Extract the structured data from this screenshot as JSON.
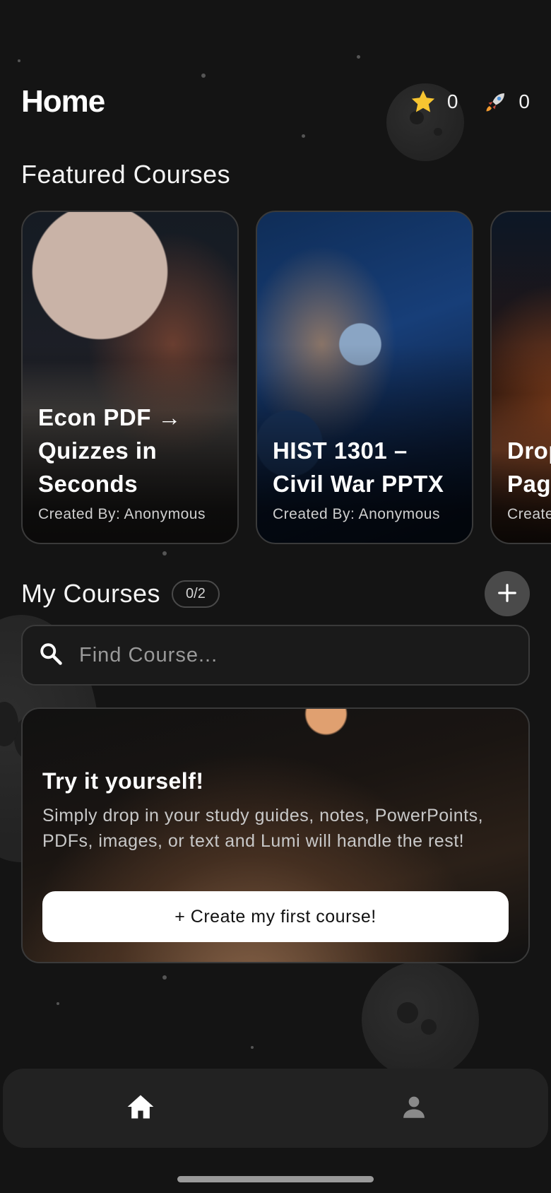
{
  "header": {
    "title": "Home",
    "stars": {
      "icon": "star-icon",
      "value": "0"
    },
    "rockets": {
      "icon": "rocket-icon",
      "value": "0"
    }
  },
  "featured": {
    "title": "Featured Courses",
    "cards": [
      {
        "title": "Econ PDF → Quizzes in Seconds",
        "author": "Created By: Anonymous"
      },
      {
        "title": "HIST 1301 – Civil War PPTX",
        "author": "Created By: Anonymous"
      },
      {
        "title": "Drop Pag",
        "author": "Create"
      }
    ]
  },
  "my_courses": {
    "title": "My Courses",
    "count": "0/2",
    "add_icon": "plus-icon"
  },
  "search": {
    "placeholder": "Find Course...",
    "value": ""
  },
  "promo": {
    "title": "Try it yourself!",
    "body": "Simply drop in your study guides, notes, PowerPoints, PDFs, images, or text and Lumi will handle the rest!",
    "button_label": "+ Create my first course!"
  },
  "nav": {
    "items": [
      {
        "icon": "home-icon",
        "active": true
      },
      {
        "icon": "person-icon",
        "active": false
      }
    ]
  },
  "colors": {
    "background": "#141414",
    "star": "#f7c531",
    "nav_background": "#222222",
    "button_background": "#ffffff"
  }
}
